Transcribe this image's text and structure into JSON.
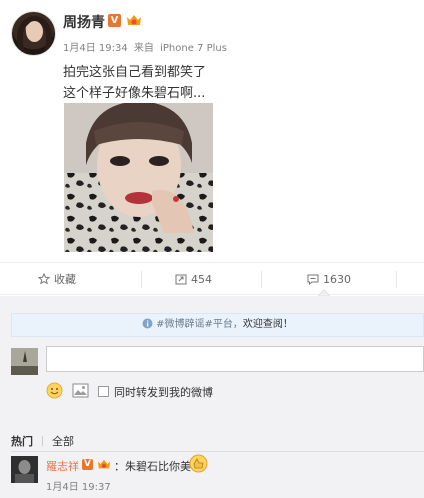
{
  "post": {
    "username": "周扬青",
    "verified_mark": "V",
    "date": "1月4日 19:34",
    "source_prefix": "来自",
    "source": "iPhone 7 Plus",
    "text_line1": "拍完这张自己看到都笑了",
    "text_line2": "这个样子好像朱碧石啊..."
  },
  "actions": {
    "favorite_label": "收藏",
    "repost_count": "454",
    "comment_count": "1630"
  },
  "comment_box": {
    "notice_prefix": "#微博辟谣#平台，",
    "notice_emphasis": "欢迎查阅！",
    "input_value": "",
    "forward_label": "同时转发到我的微博"
  },
  "comments": {
    "tab_hot": "热门",
    "tab_all": "全部",
    "items": [
      {
        "user": "羅志祥",
        "verified_mark": "V",
        "text": "：朱碧石比你美",
        "time": "1月4日 19:37"
      }
    ]
  },
  "colors": {
    "accent": "#eb7350",
    "verified": "#e8762f",
    "notice_bg": "#eaf3fb"
  }
}
